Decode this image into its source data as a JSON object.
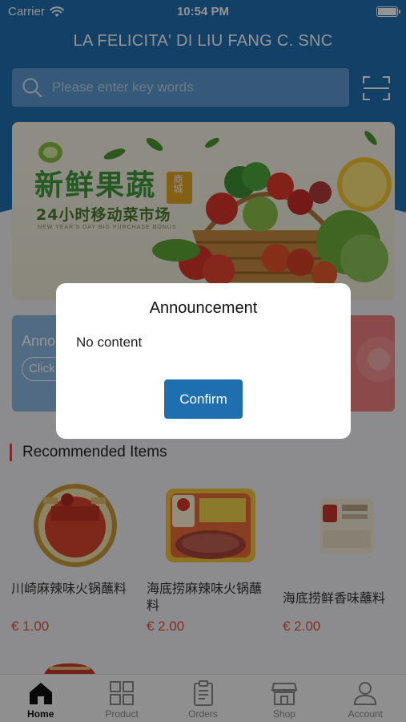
{
  "status_bar": {
    "carrier": "Carrier",
    "time": "10:54 PM"
  },
  "header": {
    "shop_name": "LA FELICITA' DI LIU FANG C. SNC"
  },
  "search": {
    "placeholder": "Please enter key words",
    "scan_icon": "scan-icon"
  },
  "banner": {
    "title": "新鲜果蔬",
    "tag": "商城",
    "subtitle": "24小时移动菜市场",
    "caption": "NEW YEAR'S DAY BIG PURCHASE BONUS"
  },
  "notice_card": {
    "label": "Anno",
    "button": "Click"
  },
  "section": {
    "title": "Recommended Items"
  },
  "products": [
    {
      "name": "川崎麻辣味火锅蘸料",
      "price": "€ 1.00"
    },
    {
      "name": "海底捞麻辣味火锅蘸料",
      "price": "€ 2.00"
    },
    {
      "name": "海底捞鲜香味蘸料",
      "price": "€ 2.00"
    }
  ],
  "tabs": [
    {
      "label": "Home",
      "icon": "home-icon",
      "active": true
    },
    {
      "label": "Product",
      "icon": "grid-icon",
      "active": false
    },
    {
      "label": "Orders",
      "icon": "clipboard-icon",
      "active": false
    },
    {
      "label": "Shop",
      "icon": "store-icon",
      "active": false
    },
    {
      "label": "Account",
      "icon": "user-icon",
      "active": false
    }
  ],
  "dialog": {
    "title": "Announcement",
    "body": "No content",
    "confirm": "Confirm"
  },
  "colors": {
    "brand": "#1f6fb0",
    "price": "#e2533f",
    "accent_red": "#e04b4b"
  }
}
